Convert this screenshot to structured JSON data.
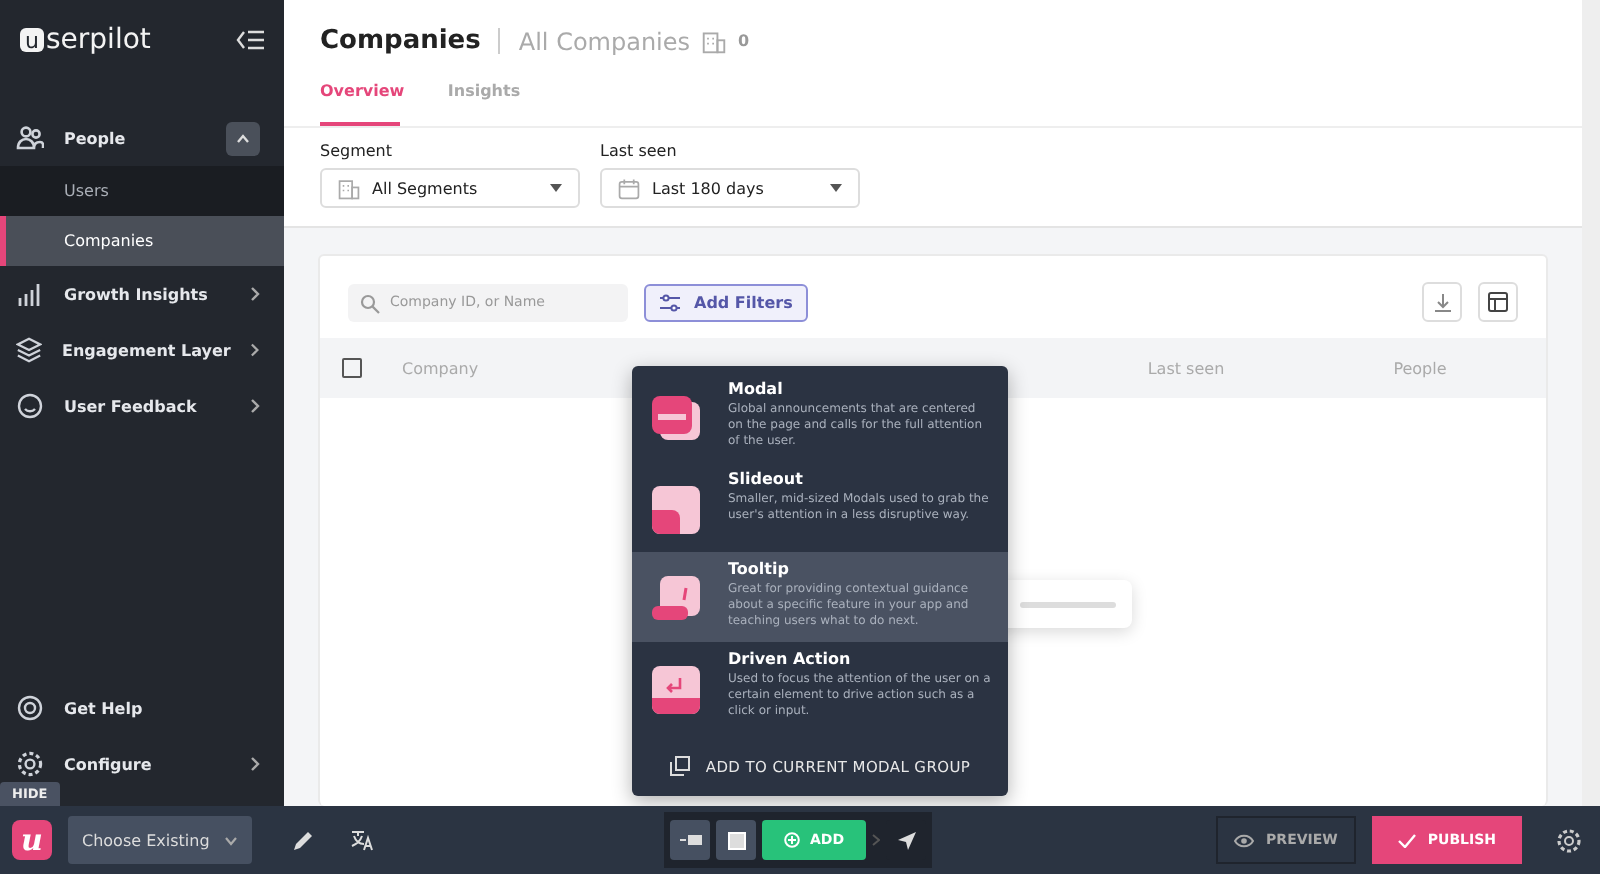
{
  "sidebar": {
    "logo_mark": "u",
    "logo_text": "serpilot",
    "nav": [
      {
        "kind": "group",
        "label": "People",
        "expanded": true,
        "children": [
          {
            "label": "Users",
            "selected": false
          },
          {
            "label": "Companies",
            "selected": true
          }
        ]
      },
      {
        "kind": "submenu",
        "label": "Growth Insights"
      },
      {
        "kind": "submenu",
        "label": "Engagement Layer"
      },
      {
        "kind": "submenu",
        "label": "User Feedback"
      }
    ],
    "footer": [
      {
        "kind": "link",
        "label": "Get Help"
      },
      {
        "kind": "submenu",
        "label": "Configure"
      }
    ]
  },
  "main": {
    "title": "Companies",
    "subtitle": "All Companies",
    "count": "0",
    "tabs": [
      {
        "label": "Overview",
        "selected": true
      },
      {
        "label": "Insights",
        "selected": false
      }
    ],
    "filters": [
      {
        "label": "Segment",
        "value": "All Segments"
      },
      {
        "label": "Last seen",
        "value": "Last 180 days"
      }
    ],
    "search": {
      "placeholder": "Company ID, or Name"
    },
    "add_filters": "Add Filters",
    "select_all": {
      "checked": false
    },
    "columns": [
      "Company",
      "Last seen",
      "People"
    ]
  },
  "menu": {
    "items": [
      {
        "kind": "modal",
        "title": "Modal",
        "description": "Global announcements that are centered on the page and calls for the full attention of the user.",
        "selected": false
      },
      {
        "kind": "slideout",
        "title": "Slideout",
        "description": "Smaller, mid-sized Modals used to grab the user's attention in a less disruptive way.",
        "selected": false
      },
      {
        "kind": "tooltip",
        "title": "Tooltip",
        "description": "Great for providing contextual guidance about a specific feature in your app and teaching users what to do next.",
        "selected": true
      },
      {
        "kind": "driven",
        "title": "Driven Action",
        "description": "Used to focus the attention of the user on a certain element to drive action such as a click or input.",
        "selected": false
      }
    ],
    "footer": "ADD TO CURRENT MODAL GROUP"
  },
  "bottom_bar": {
    "hide": "HIDE",
    "logo": "u",
    "select": "Choose Existing",
    "add": "ADD",
    "preview": "PREVIEW",
    "publish": "PUBLISH"
  }
}
